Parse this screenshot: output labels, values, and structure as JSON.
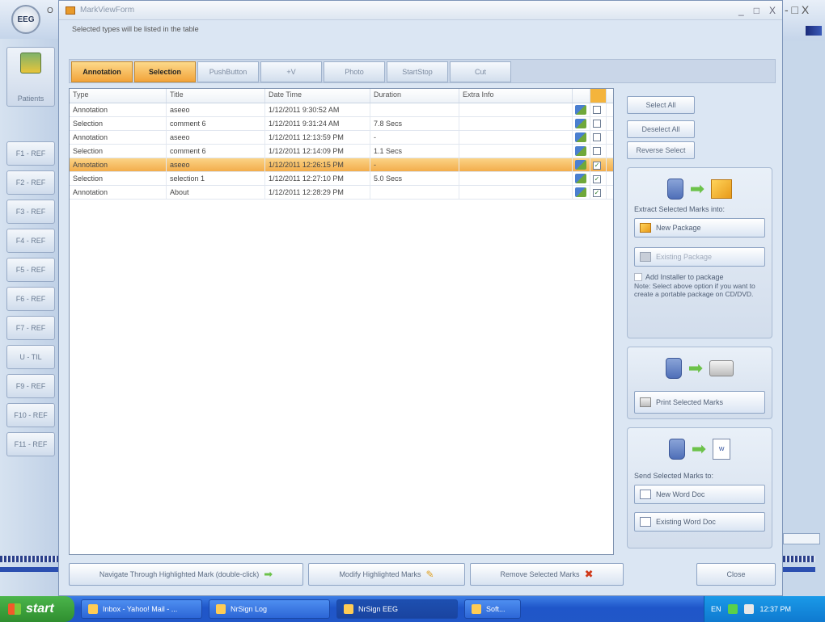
{
  "background": {
    "logo_text": "EEG",
    "title_fragment": "O",
    "patients_label": "Patients",
    "side_buttons": [
      "F1 - REF",
      "F2 - REF",
      "F3 - REF",
      "F4 - REF",
      "F5 - REF",
      "F6 - REF",
      "F7 - REF",
      "U - TIL",
      "F9 - REF",
      "F10 - REF",
      "F11 - REF"
    ],
    "right_top": "- □ X"
  },
  "dialog": {
    "title": "MarkViewForm",
    "minimize": "_",
    "restore": "□",
    "close": "X",
    "hint": "Selected types will be listed in the table",
    "tabs": [
      {
        "label": "Annotation",
        "active": true
      },
      {
        "label": "Selection",
        "active": true
      },
      {
        "label": "PushButton",
        "active": false
      },
      {
        "label": "+V",
        "active": false
      },
      {
        "label": "Photo",
        "active": false
      },
      {
        "label": "StartStop",
        "active": false
      },
      {
        "label": "Cut",
        "active": false
      }
    ]
  },
  "table": {
    "columns": [
      "Type",
      "Title",
      "Date Time",
      "Duration",
      "Extra Info",
      "",
      ""
    ],
    "rows": [
      {
        "type": "Annotation",
        "title": "aseeo",
        "datetime": "1/12/2011 9:30:52 AM",
        "duration": "",
        "extra": "",
        "checked": false,
        "highlighted": false
      },
      {
        "type": "Selection",
        "title": "comment 6",
        "datetime": "1/12/2011 9:31:24 AM",
        "duration": "7.8 Secs",
        "extra": "",
        "checked": false,
        "highlighted": false
      },
      {
        "type": "Annotation",
        "title": "aseeo",
        "datetime": "1/12/2011 12:13:59 PM",
        "duration": "-",
        "extra": "",
        "checked": false,
        "highlighted": false
      },
      {
        "type": "Selection",
        "title": "comment 6",
        "datetime": "1/12/2011 12:14:09 PM",
        "duration": "1.1 Secs",
        "extra": "",
        "checked": false,
        "highlighted": false
      },
      {
        "type": "Annotation",
        "title": "aseeo",
        "datetime": "1/12/2011 12:26:15 PM",
        "duration": "-",
        "extra": "",
        "checked": true,
        "highlighted": true
      },
      {
        "type": "Selection",
        "title": "selection 1",
        "datetime": "1/12/2011 12:27:10 PM",
        "duration": "5.0 Secs",
        "extra": "",
        "checked": true,
        "highlighted": false
      },
      {
        "type": "Annotation",
        "title": "About",
        "datetime": "1/12/2011 12:28:29 PM",
        "duration": "",
        "extra": "",
        "checked": true,
        "highlighted": false
      }
    ]
  },
  "right_panel": {
    "select_all": "Select All",
    "deselect_all": "Deselect All",
    "reverse_select": "Reverse Select",
    "extract_label": "Extract Selected Marks into:",
    "new_package": "New Package",
    "existing_package": "Existing Package",
    "add_installer": "Add Installer to package",
    "note": "Note: Select above option if you want to create a portable package on CD/DVD.",
    "print_marks": "Print Selected Marks",
    "send_label": "Send Selected Marks to:",
    "new_word_doc": "New Word Doc",
    "existing_word_doc": "Existing Word Doc"
  },
  "bottom": {
    "navigate": "Navigate Through Highlighted Mark (double-click)",
    "modify": "Modify Highlighted Marks",
    "remove": "Remove Selected Marks",
    "close": "Close"
  },
  "taskbar": {
    "start": "start",
    "tasks": [
      {
        "label": "Inbox - Yahoo! Mail - ...",
        "active": false
      },
      {
        "label": "NrSign Log",
        "active": false
      },
      {
        "label": "NrSign EEG",
        "active": true
      },
      {
        "label": "Soft...",
        "active": false
      }
    ],
    "lang": "EN",
    "clock": "12:37 PM"
  }
}
